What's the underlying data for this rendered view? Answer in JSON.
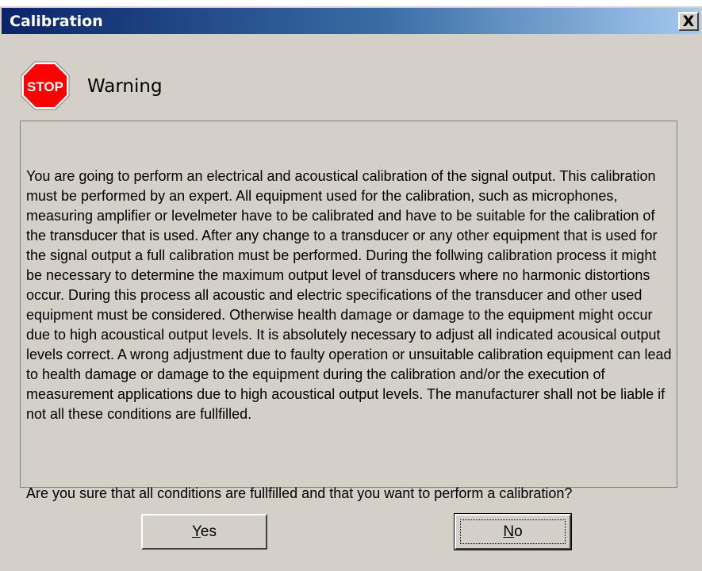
{
  "window": {
    "title": "Calibration",
    "close_label": "X"
  },
  "header": {
    "icon": "stop-sign-icon",
    "icon_text": "STOP",
    "icon_color": "#ff0000",
    "title": "Warning"
  },
  "message": {
    "paragraph1": "You are going to perform an electrical and acoustical calibration of the signal output. This calibration must be performed by an expert. All equipment used for the calibration, such as microphones, measuring amplifier or levelmeter have to be calibrated and have to be suitable for the calibration of the transducer that is used. After any change to a transducer or any other equipment that is used for the signal output a full calibration must be performed. During the follwing calibration process it might be necessary to determine the maximum output level of transducers where no harmonic distortions occur. During this process all acoustic and electric specifications of the transducer and other used equipment must be considered. Otherwise health damage or damage to the equipment might occur due to high acoustical output levels. It is absolutely necessary to adjust all indicated acousical output levels correct. A wrong adjustment due to faulty operation or unsuitable calibration equipment can lead to health damage or damage to the equipment during the calibration and/or the execution of measurement applications due to high acoustical output levels. The manufacturer shall not be liable if not all these conditions are fullfilled.",
    "paragraph2": "Are you sure that all conditions are fullfilled and that you want to perform a calibration?"
  },
  "buttons": {
    "yes": {
      "mnemonic": "Y",
      "rest": "es"
    },
    "no": {
      "mnemonic": "N",
      "rest": "o"
    }
  },
  "colors": {
    "titlebar_start": "#0a246a",
    "titlebar_end": "#a6caf0",
    "dialog_bg": "#d4d0c8"
  }
}
